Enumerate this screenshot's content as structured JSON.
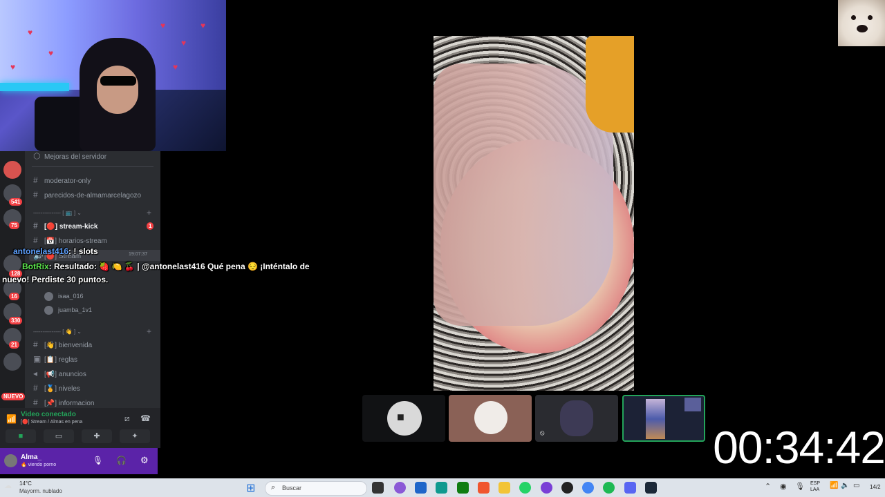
{
  "discord": {
    "boost_label": "Mejoras del servidor",
    "channels_top": [
      "moderator-only",
      "parecidos-de-almamarcelagozo"
    ],
    "category_1_label": "[ 📺 ]",
    "stream_kick_label": "stream-kick",
    "stream_kick_badge": "1",
    "horarios_label": "horarios-stream",
    "stream_voice_label": "Stream",
    "voice_users": [
      "isaa_016",
      "juamba_1v1"
    ],
    "category_2_label": "[ 👋 ]",
    "channels_bottom": [
      "bienvenida",
      "reglas",
      "anuncios",
      "niveles",
      "informacion"
    ],
    "server_badges": [
      "541",
      "75",
      "128",
      "16",
      "330",
      "21"
    ],
    "new_label": "NUEVO"
  },
  "voice_panel": {
    "status": "Video conectado",
    "channel": "Stream / Almas en pena"
  },
  "user_panel": {
    "name": "Alma_",
    "status": "viendo porno"
  },
  "chat": {
    "line1_user": "antonelast416",
    "line1_text": ": ! slots",
    "line1_time": "19:07:37",
    "line2_user": "BotRix",
    "line2_text_a": ": Resultado:",
    "line2_text_b": "| @antonelast416 Qué pena 😔 ¡Inténtalo de",
    "line3_text": "nuevo! Perdiste 30 puntos."
  },
  "timer": "00:34:42",
  "taskbar": {
    "weather_temp": "14°C",
    "weather_desc": "Mayorm. nublado",
    "search_placeholder": "Buscar",
    "lang_1": "ESP",
    "lang_2": "LAA",
    "clock": "14/2"
  },
  "colors": {
    "discord_bg": "#2b2d31",
    "server_bar": "#1e1f22",
    "user_panel": "#5b23a8",
    "connected_green": "#23a55a",
    "chat_user_blue": "#5ea1ff",
    "chat_bot_green": "#5eea4f"
  }
}
